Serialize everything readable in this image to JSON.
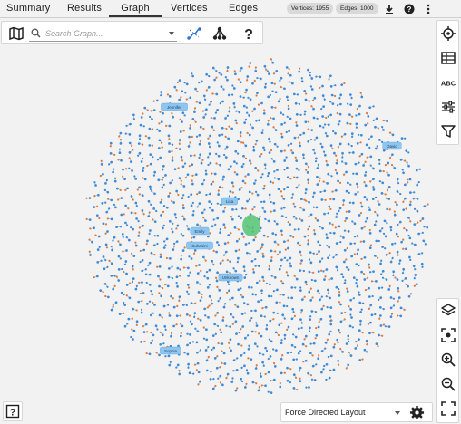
{
  "tabs": [
    {
      "label": "Summary",
      "active": false
    },
    {
      "label": "Results",
      "active": false
    },
    {
      "label": "Graph",
      "active": true
    },
    {
      "label": "Vertices",
      "active": false
    },
    {
      "label": "Edges",
      "active": false
    }
  ],
  "badges": {
    "vertices": "Vertices: 1955",
    "edges": "Edges: 1000"
  },
  "toolbar": {
    "search_placeholder": "Search Graph..."
  },
  "node_labels": [
    {
      "text": "Jennifer"
    },
    {
      "text": "David"
    },
    {
      "text": "Lisa"
    },
    {
      "text": "Emily"
    },
    {
      "text": "Suhasini"
    },
    {
      "text": "Unknown"
    },
    {
      "text": "Sophia"
    }
  ],
  "layout": {
    "selected": "Force Directed Layout"
  },
  "colors": {
    "vertex": "#3d8bd8",
    "edge_end": "#e07a3a",
    "label_bg": "#8ec6f0",
    "selection": "#55c472"
  },
  "icons": [
    "map-icon",
    "search-icon",
    "dropdown-caret-icon",
    "path-icon",
    "hierarchy-icon",
    "help-icon",
    "download-icon",
    "question-circle-icon",
    "more-vert-icon",
    "crosshair-icon",
    "table-icon",
    "abc-icon",
    "sliders-icon",
    "filter-icon",
    "layers-icon",
    "focus-icon",
    "zoom-in-icon",
    "zoom-out-icon",
    "fullscreen-icon",
    "help-box-icon",
    "settings-icon"
  ]
}
